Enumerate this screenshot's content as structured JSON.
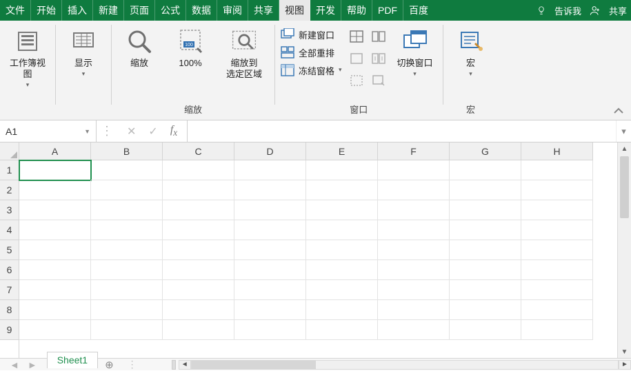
{
  "tabs": {
    "file": "文件",
    "home": "开始",
    "insert": "插入",
    "new": "新建",
    "page": "页面",
    "formula": "公式",
    "data": "数据",
    "review": "审阅",
    "share": "共享",
    "view": "视图",
    "develop": "开发",
    "help": "帮助",
    "pdf": "PDF",
    "baidu": "百度",
    "tellme": "告诉我",
    "sharebtn": "共享"
  },
  "ribbon": {
    "workbook_views": "工作簿视图",
    "display": "显示",
    "zoom_btn": "缩放",
    "zoom100": "100%",
    "zoom_selection_l1": "缩放到",
    "zoom_selection_l2": "选定区域",
    "zoom_group": "缩放",
    "new_window": "新建窗口",
    "arrange_all": "全部重排",
    "freeze_panes": "冻结窗格",
    "switch_window": "切换窗口",
    "window_group": "窗口",
    "macros": "宏",
    "macros_group": "宏"
  },
  "namebox": "A1",
  "columns": [
    "A",
    "B",
    "C",
    "D",
    "E",
    "F",
    "G",
    "H"
  ],
  "rows": [
    "1",
    "2",
    "3",
    "4",
    "5",
    "6",
    "7",
    "8",
    "9"
  ],
  "sheet": "Sheet1"
}
